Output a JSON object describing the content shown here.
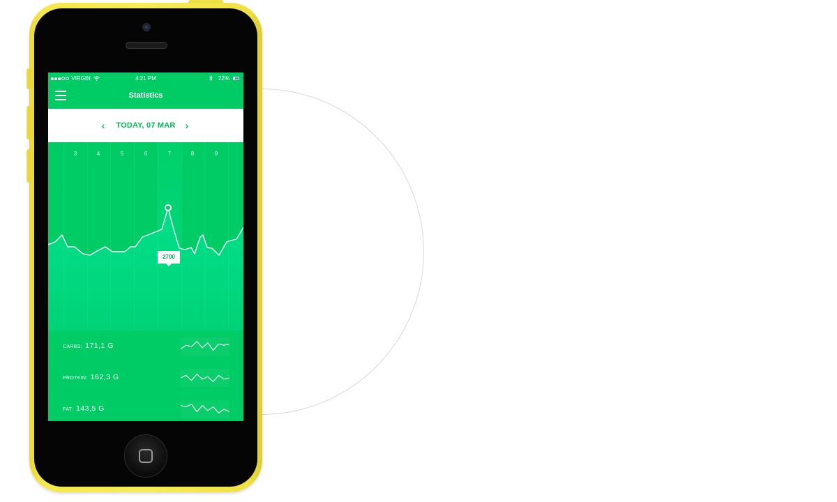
{
  "status_bar": {
    "carrier": "VIRGIN",
    "time": "4:21 PM",
    "battery": "22%",
    "signal_dots_filled": 3,
    "signal_dots_total": 5
  },
  "nav": {
    "title": "Statistics"
  },
  "date_bar": {
    "prev_symbol": "‹",
    "label": "TODAY, 07 MAR",
    "next_symbol": "›"
  },
  "chart": {
    "days": [
      "3",
      "4",
      "5",
      "6",
      "7",
      "8",
      "9"
    ],
    "selected_day": "7",
    "tooltip_value": "2700",
    "colors": {
      "background": "#00cc66",
      "line": "#ffffff",
      "fill": "#00dd88",
      "datebar_text": "#00b85a"
    }
  },
  "macros": [
    {
      "label": "CARBS:",
      "value": "171,1 G",
      "sparkline": [
        0.3,
        0.6,
        0.5,
        0.9,
        0.4,
        0.8,
        0.2,
        0.7,
        0.6,
        0.7
      ]
    },
    {
      "label": "PROTEIN:",
      "value": "162,3 G",
      "sparkline": [
        0.5,
        0.7,
        0.3,
        0.8,
        0.4,
        0.6,
        0.2,
        0.7,
        0.4,
        0.5
      ]
    },
    {
      "label": "FAT:",
      "value": "143,5 G",
      "sparkline": [
        0.8,
        0.7,
        0.9,
        0.3,
        0.8,
        0.4,
        0.7,
        0.2,
        0.5,
        0.3
      ]
    }
  ],
  "icons": [
    "menu-icon",
    "wifi-icon",
    "bluetooth-icon",
    "battery-icon",
    "chevron-left-icon",
    "chevron-right-icon",
    "home-button-icon"
  ]
}
